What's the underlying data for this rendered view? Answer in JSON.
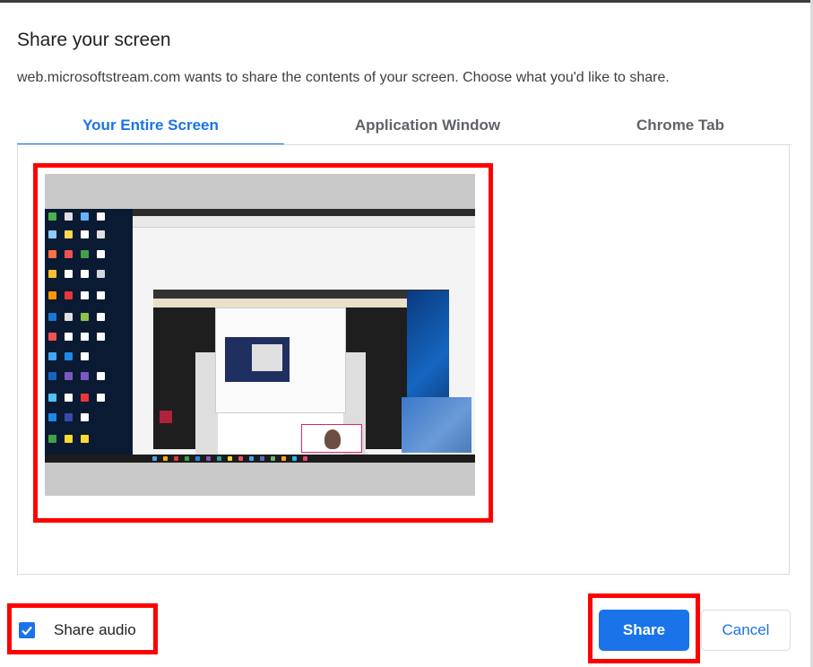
{
  "dialog": {
    "title": "Share your screen",
    "description": "web.microsoftstream.com wants to share the contents of your screen. Choose what you'd like to share."
  },
  "tabs": [
    {
      "label": "Your Entire Screen",
      "active": true
    },
    {
      "label": "Application Window",
      "active": false
    },
    {
      "label": "Chrome Tab",
      "active": false
    }
  ],
  "audio": {
    "label": "Share audio",
    "checked": true
  },
  "buttons": {
    "share_label": "Share",
    "cancel_label": "Cancel"
  },
  "colors": {
    "accent": "#1a73e8",
    "highlight": "#ff0000"
  },
  "icons": {
    "checkbox": "checkmark-icon"
  }
}
